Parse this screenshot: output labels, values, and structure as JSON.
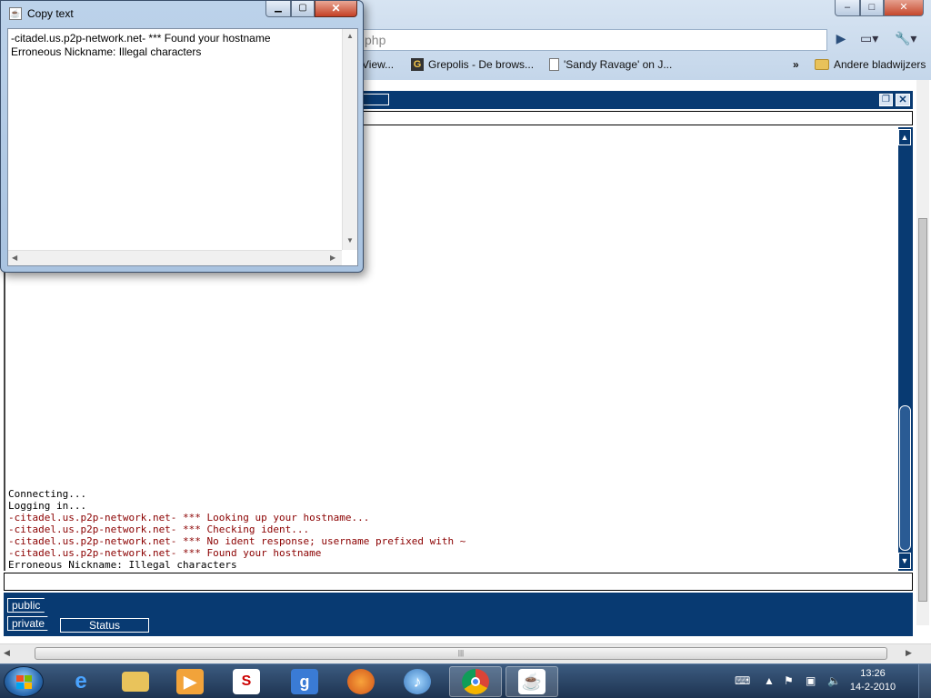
{
  "browser": {
    "omnibox_text": "php",
    "bookmarks": {
      "partial_label": "View...",
      "grepolis_label": "Grepolis - De brows...",
      "sandy_label": "'Sandy Ravage' on J...",
      "overflow": "»",
      "other_bookmarks": "Andere bladwijzers"
    },
    "window_controls": {
      "min": "–",
      "max": "□",
      "close": "✕"
    }
  },
  "copy_dialog": {
    "title": "Copy text",
    "text": "-citadel.us.p2p-network.net- *** Found your hostname\nErroneous Nickname: Illegal characters",
    "controls": {
      "min": "▁",
      "max": "▢",
      "close": "✕"
    }
  },
  "chat": {
    "lines": [
      {
        "text": "Connecting...",
        "kind": "normal"
      },
      {
        "text": "Logging in...",
        "kind": "normal"
      },
      {
        "text": "-citadel.us.p2p-network.net- *** Looking up your hostname...",
        "kind": "server"
      },
      {
        "text": "-citadel.us.p2p-network.net- *** Checking ident...",
        "kind": "server"
      },
      {
        "text": "-citadel.us.p2p-network.net- *** No ident response; username prefixed with ~",
        "kind": "server"
      },
      {
        "text": "-citadel.us.p2p-network.net- *** Found your hostname",
        "kind": "server"
      },
      {
        "text": "Erroneous Nickname: Illegal characters",
        "kind": "normal"
      }
    ],
    "tabs": {
      "public": "public",
      "private": "private",
      "status": "Status"
    }
  },
  "taskbar": {
    "clock_time": "13:26",
    "clock_date": "14-2-2010",
    "apps": [
      "internet-explorer",
      "windows-explorer",
      "media-player",
      "sbp",
      "gmail-g",
      "firefox",
      "itunes",
      "chrome",
      "java"
    ]
  }
}
